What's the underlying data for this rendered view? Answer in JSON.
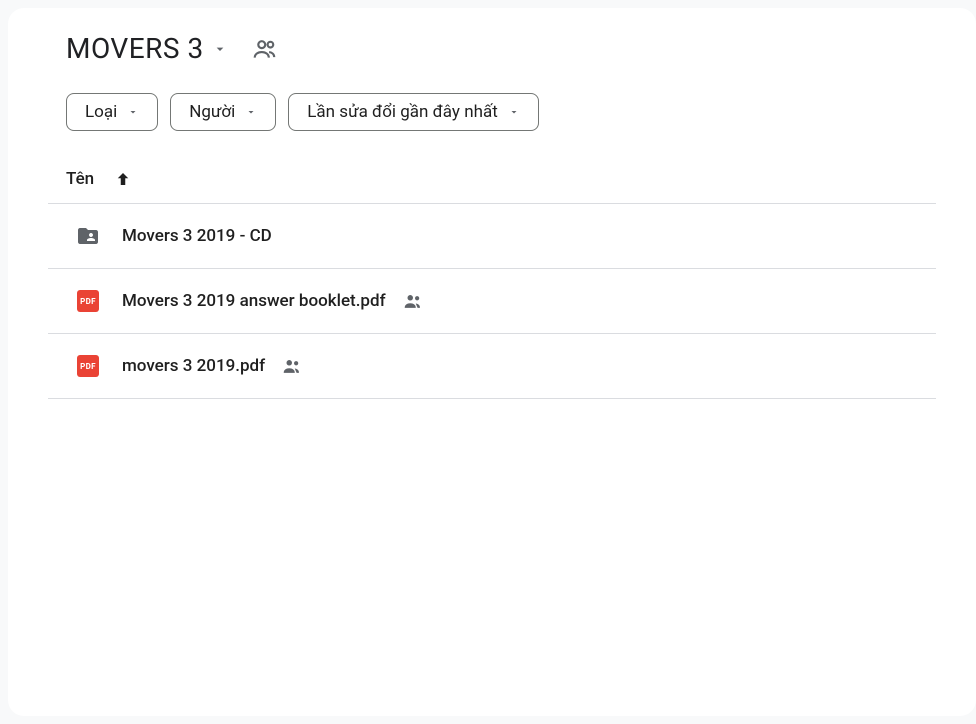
{
  "folder": {
    "title": "MOVERS 3"
  },
  "filters": {
    "type": "Loại",
    "people": "Người",
    "modified": "Lần sửa đổi gần đây nhất"
  },
  "columns": {
    "name": "Tên"
  },
  "files": [
    {
      "name": "Movers 3 2019 - CD",
      "type": "folder",
      "shared": false
    },
    {
      "name": "Movers 3 2019 answer booklet.pdf",
      "type": "pdf",
      "shared": true
    },
    {
      "name": "movers 3 2019.pdf",
      "type": "pdf",
      "shared": true
    }
  ],
  "icons": {
    "pdf_label": "PDF"
  }
}
